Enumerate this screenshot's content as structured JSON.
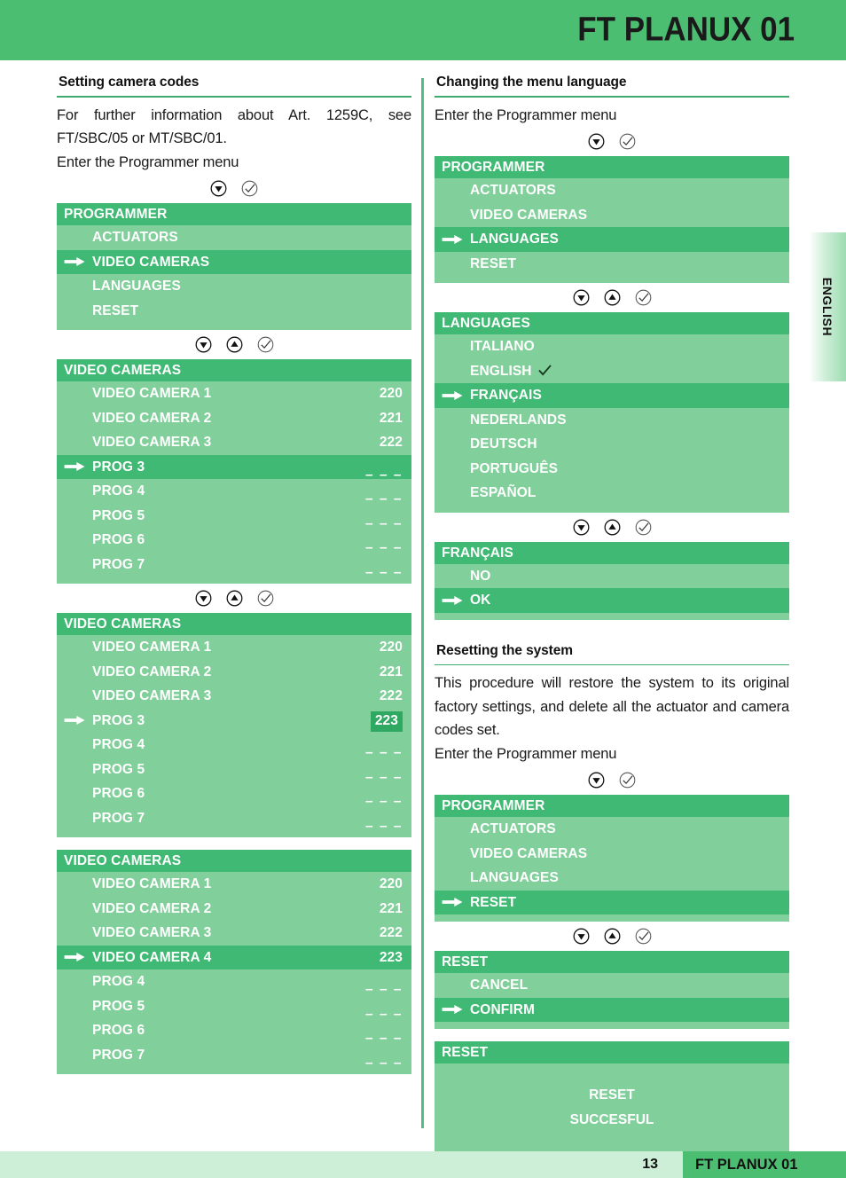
{
  "header": {
    "title": "FT PLANUX 01"
  },
  "side_tab": {
    "label": "ENGLISH"
  },
  "footer": {
    "page_number": "13",
    "doc_title": "FT PLANUX 01"
  },
  "icons": {
    "down": "down-arrow-key",
    "up": "up-arrow-key",
    "confirm": "confirm-check-key",
    "cursor": "right-arrow-cursor",
    "selected_check": "check-mark"
  },
  "left_column": {
    "heading": "Setting camera codes",
    "paragraph": "For further information about Art. 1259C, see FT/SBC/05 or MT/SBC/01.",
    "paragraph2": "Enter the Programmer menu",
    "screens": [
      {
        "title": "PROGRAMMER",
        "rows": [
          {
            "label": "ACTUATORS",
            "value": "",
            "selected": false
          },
          {
            "label": "VIDEO CAMERAS",
            "value": "",
            "selected": true
          },
          {
            "label": "LANGUAGES",
            "value": "",
            "selected": false
          },
          {
            "label": "RESET",
            "value": "",
            "selected": false
          }
        ]
      },
      {
        "title": "VIDEO CAMERAS",
        "rows": [
          {
            "label": "VIDEO CAMERA 1",
            "value": "220",
            "selected": false
          },
          {
            "label": "VIDEO CAMERA 2",
            "value": "221",
            "selected": false
          },
          {
            "label": "VIDEO CAMERA 3",
            "value": "222",
            "selected": false
          },
          {
            "label": "PROG 3",
            "value": "– – –",
            "dash": true,
            "selected": true
          },
          {
            "label": "PROG 4",
            "value": "– – –",
            "dash": true,
            "selected": false
          },
          {
            "label": "PROG 5",
            "value": "– – –",
            "dash": true,
            "selected": false
          },
          {
            "label": "PROG 6",
            "value": "– – –",
            "dash": true,
            "selected": false
          },
          {
            "label": "PROG 7",
            "value": "– – –",
            "dash": true,
            "selected": false
          }
        ]
      },
      {
        "title": "VIDEO CAMERAS",
        "rows": [
          {
            "label": "VIDEO CAMERA 1",
            "value": "220",
            "selected": false
          },
          {
            "label": "VIDEO CAMERA 2",
            "value": "221",
            "selected": false
          },
          {
            "label": "VIDEO CAMERA 3",
            "value": "222",
            "selected": false
          },
          {
            "label": "PROG 3",
            "value": "223",
            "boxed": true,
            "selected": false,
            "cursor": true
          },
          {
            "label": "PROG 4",
            "value": "– – –",
            "dash": true,
            "selected": false
          },
          {
            "label": "PROG 5",
            "value": "– – –",
            "dash": true,
            "selected": false
          },
          {
            "label": "PROG 6",
            "value": "– – –",
            "dash": true,
            "selected": false
          },
          {
            "label": "PROG 7",
            "value": "– – –",
            "dash": true,
            "selected": false
          }
        ]
      },
      {
        "title": "VIDEO CAMERAS",
        "rows": [
          {
            "label": "VIDEO CAMERA 1",
            "value": "220",
            "selected": false
          },
          {
            "label": "VIDEO CAMERA 2",
            "value": "221",
            "selected": false
          },
          {
            "label": "VIDEO CAMERA 3",
            "value": "222",
            "selected": false
          },
          {
            "label": "VIDEO CAMERA 4",
            "value": "223",
            "selected": true
          },
          {
            "label": "PROG 4",
            "value": "– – –",
            "dash": true,
            "selected": false
          },
          {
            "label": "PROG 5",
            "value": "– – –",
            "dash": true,
            "selected": false
          },
          {
            "label": "PROG 6",
            "value": "– – –",
            "dash": true,
            "selected": false
          },
          {
            "label": "PROG 7",
            "value": "– – –",
            "dash": true,
            "selected": false
          }
        ]
      }
    ]
  },
  "right_column": {
    "section1": {
      "heading": "Changing the menu language",
      "paragraph": "Enter the Programmer menu",
      "screens": [
        {
          "title": "PROGRAMMER",
          "rows": [
            {
              "label": "ACTUATORS",
              "value": "",
              "selected": false
            },
            {
              "label": "VIDEO CAMERAS",
              "value": "",
              "selected": false
            },
            {
              "label": "LANGUAGES",
              "value": "",
              "selected": true
            },
            {
              "label": "RESET",
              "value": "",
              "selected": false
            }
          ]
        },
        {
          "title": "LANGUAGES",
          "rows": [
            {
              "label": "ITALIANO",
              "value": "",
              "selected": false
            },
            {
              "label": "ENGLISH",
              "value": "",
              "selected": false,
              "checked": true
            },
            {
              "label": "FRANÇAIS",
              "value": "",
              "selected": true
            },
            {
              "label": "NEDERLANDS",
              "value": "",
              "selected": false
            },
            {
              "label": "DEUTSCH",
              "value": "",
              "selected": false
            },
            {
              "label": "PORTUGUÊS",
              "value": "",
              "selected": false
            },
            {
              "label": "ESPAÑOL",
              "value": "",
              "selected": false
            }
          ]
        },
        {
          "title": "FRANÇAIS",
          "rows": [
            {
              "label": "NO",
              "value": "",
              "selected": false
            },
            {
              "label": "OK",
              "value": "",
              "selected": true
            }
          ]
        }
      ]
    },
    "section2": {
      "heading": "Resetting the system",
      "paragraph": "This procedure will restore the system to its original factory settings, and delete all the actuator and camera codes set.",
      "paragraph2": "Enter the Programmer menu",
      "screens": [
        {
          "title": "PROGRAMMER",
          "rows": [
            {
              "label": "ACTUATORS",
              "value": "",
              "selected": false
            },
            {
              "label": "VIDEO CAMERAS",
              "value": "",
              "selected": false
            },
            {
              "label": "LANGUAGES",
              "value": "",
              "selected": false
            },
            {
              "label": "RESET",
              "value": "",
              "selected": true
            }
          ]
        },
        {
          "title": "RESET",
          "rows": [
            {
              "label": "CANCEL",
              "value": "",
              "selected": false
            },
            {
              "label": "CONFIRM",
              "value": "",
              "selected": true
            }
          ]
        }
      ],
      "result_screen": {
        "title": "RESET",
        "message_line1": "RESET",
        "message_line2": "SUCCESFUL"
      }
    }
  },
  "colors": {
    "brand_green": "#4cbe72",
    "screen_header_green": "#3fb973",
    "screen_body_green": "#81cf9b",
    "value_box_green": "#2fa862",
    "footer_light_green": "#cdeed7",
    "rule_green": "#3faa6d"
  }
}
